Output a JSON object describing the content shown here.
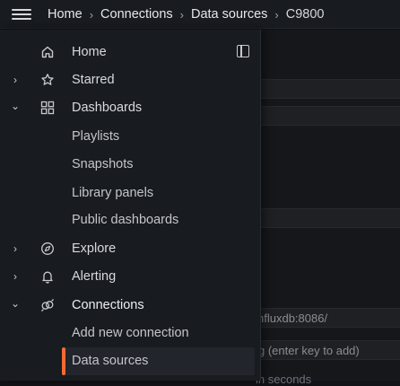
{
  "topbar": {
    "breadcrumb": [
      "Home",
      "Connections",
      "Data sources",
      "C9800"
    ]
  },
  "background": {
    "url_fragment": "nfluxdb:8086/",
    "tag_hint": "g (enter key to add)",
    "seconds_hint": "in seconds"
  },
  "menu": {
    "items": [
      {
        "label": "Home",
        "icon": "home-icon",
        "chevron": ""
      },
      {
        "label": "Starred",
        "icon": "star-icon",
        "chevron": "›"
      },
      {
        "label": "Dashboards",
        "icon": "apps-icon",
        "chevron": "⌄"
      },
      {
        "label": "Playlists"
      },
      {
        "label": "Snapshots"
      },
      {
        "label": "Library panels"
      },
      {
        "label": "Public dashboards"
      },
      {
        "label": "Explore",
        "icon": "compass-icon",
        "chevron": "›"
      },
      {
        "label": "Alerting",
        "icon": "bell-icon",
        "chevron": "›"
      },
      {
        "label": "Connections",
        "icon": "connections-icon",
        "chevron": "⌄"
      },
      {
        "label": "Add new connection"
      },
      {
        "label": "Data sources"
      }
    ],
    "active_item": "Data sources",
    "accent_color": "#f46b32"
  }
}
